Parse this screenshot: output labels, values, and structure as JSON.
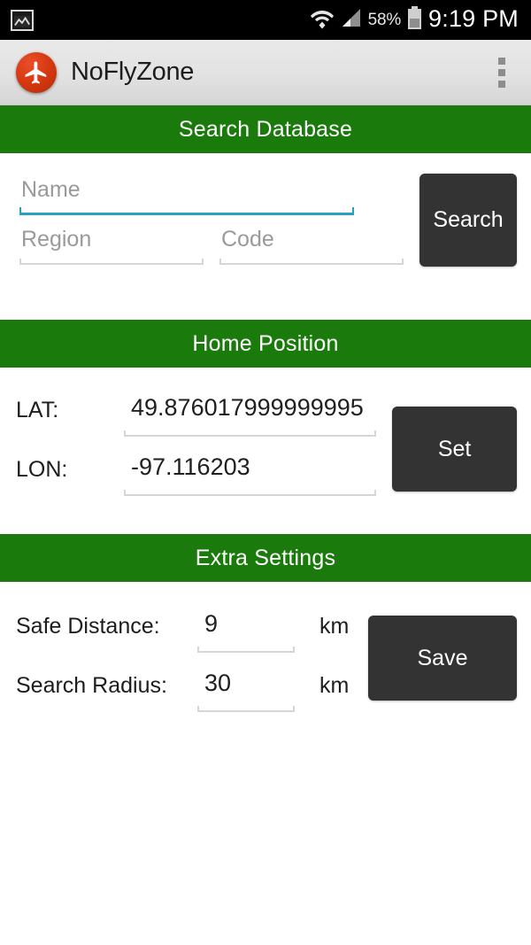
{
  "statusbar": {
    "left_icon": "photo-icon",
    "wifi_icon": "wifi-icon",
    "signal_icon": "cell-signal-icon",
    "battery_percent": "58%",
    "battery_icon": "battery-icon",
    "clock": "9:19 PM"
  },
  "appbar": {
    "app_icon": "airplane-icon",
    "title": "NoFlyZone",
    "overflow_label": "More options"
  },
  "colors": {
    "section_green": "#1a7a0c",
    "button_dark": "#333333",
    "focus_underline": "#24a3bf",
    "app_icon_red": "#d83a12",
    "statusbar_black": "#000000",
    "appbar_gray": "#e2e2e2"
  },
  "sections": {
    "search": {
      "header": "Search Database",
      "name_placeholder": "Name",
      "name_value": "",
      "region_placeholder": "Region",
      "region_value": "",
      "code_placeholder": "Code",
      "code_value": "",
      "button_label": "Search"
    },
    "home_position": {
      "header": "Home Position",
      "lat_label": "LAT:",
      "lat_value": "49.876017999999995",
      "lon_label": "LON:",
      "lon_value": "-97.116203",
      "button_label": "Set"
    },
    "extra_settings": {
      "header": "Extra Settings",
      "safe_distance_label": "Safe Distance:",
      "safe_distance_value": "9",
      "safe_distance_unit": "km",
      "search_radius_label": "Search Radius:",
      "search_radius_value": "30",
      "search_radius_unit": "km",
      "button_label": "Save"
    }
  }
}
